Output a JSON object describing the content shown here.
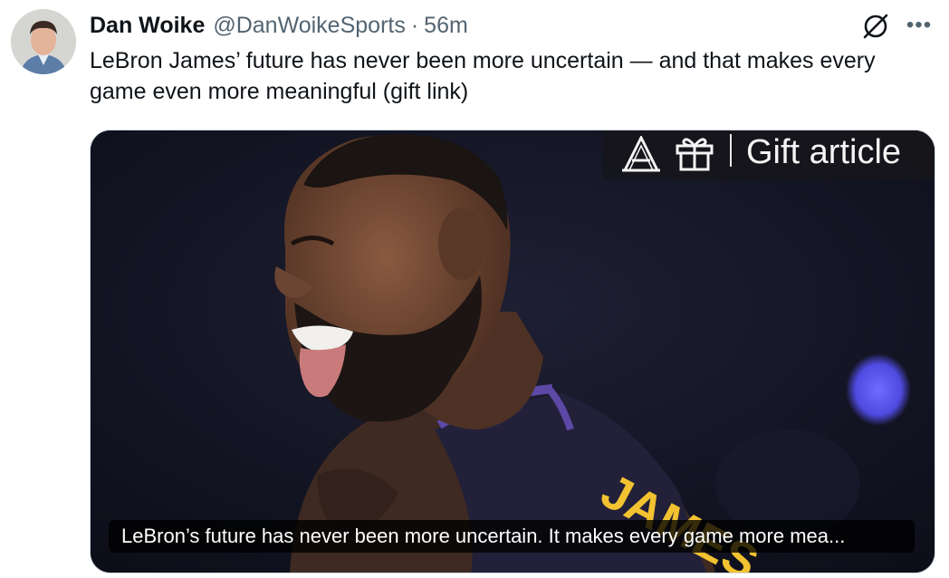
{
  "author": {
    "name": "Dan Woike",
    "handle": "@DanWoikeSports",
    "separator": "·",
    "time": "56m"
  },
  "tweet": {
    "text": "LeBron James’ future has never been more uncertain — and that makes every game even more meaningful (gift link)"
  },
  "card": {
    "badge_label": "Gift article",
    "caption": "LeBron’s future has never been more uncertain. It makes every game more mea...",
    "jersey_text": "JAMES"
  },
  "icons": {
    "grok": "grok-icon",
    "more": "more-icon",
    "publisher_logo": "the-athletic-logo",
    "gift": "gift-icon"
  },
  "colors": {
    "text_primary": "#0f1419",
    "text_secondary": "#536471",
    "photo_background": "#121321",
    "jersey_gold": "#f2c230"
  }
}
